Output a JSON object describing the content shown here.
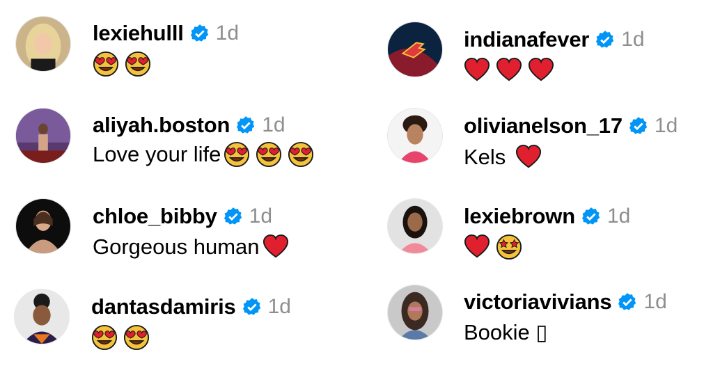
{
  "comments": [
    {
      "username": "lexiehulll",
      "time": "1d",
      "text": "",
      "emojis": [
        "heart-eyes",
        "heart-eyes"
      ]
    },
    {
      "username": "aliyah.boston",
      "time": "1d",
      "text": "Love your life",
      "emojis": [
        "heart-eyes",
        "heart-eyes",
        "heart-eyes"
      ]
    },
    {
      "username": "chloe_bibby",
      "time": "1d",
      "text": "Gorgeous human",
      "emojis": [
        "red-heart"
      ]
    },
    {
      "username": "dantasdamiris",
      "time": "1d",
      "text": "",
      "emojis": [
        "heart-eyes",
        "heart-eyes"
      ]
    },
    {
      "username": "indianafever",
      "time": "1d",
      "text": "",
      "emojis": [
        "red-heart",
        "red-heart",
        "red-heart"
      ]
    },
    {
      "username": "olivianelson_17",
      "time": "1d",
      "text": "Kels",
      "emojis": [
        "red-heart"
      ]
    },
    {
      "username": "lexiebrown",
      "time": "1d",
      "text": "",
      "emojis": [
        "red-heart",
        "star-struck"
      ]
    },
    {
      "username": "victoriavivians",
      "time": "1d",
      "text": "Bookie ▯",
      "emojis": []
    }
  ],
  "colors": {
    "verified": "#0095f6",
    "time": "#8e8e8e",
    "heart": "#e0202e",
    "emoji_face": "#f5c33b"
  }
}
